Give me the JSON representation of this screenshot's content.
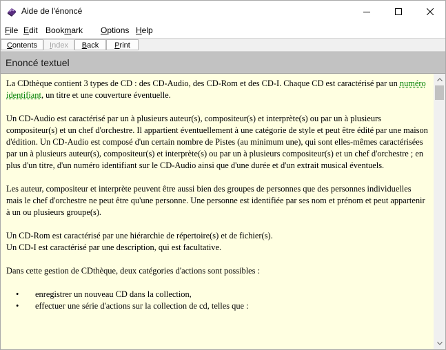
{
  "window": {
    "title": "Aide de l'énoncé"
  },
  "menu": [
    {
      "pre": "",
      "key": "F",
      "post": "ile"
    },
    {
      "pre": "",
      "key": "E",
      "post": "dit"
    },
    {
      "pre": "Book",
      "key": "m",
      "post": "ark"
    },
    {
      "pre": "",
      "key": "O",
      "post": "ptions"
    },
    {
      "pre": "",
      "key": "H",
      "post": "elp"
    }
  ],
  "toolbar": {
    "contents": {
      "pre": "",
      "key": "C",
      "post": "ontents"
    },
    "index": {
      "pre": "",
      "key": "I",
      "post": "ndex"
    },
    "back": {
      "pre": "",
      "key": "B",
      "post": "ack"
    },
    "print": {
      "pre": "",
      "key": "P",
      "post": "rint"
    }
  },
  "heading": "Enoncé textuel",
  "content": {
    "p1_before": "La CDthèque contient 3 types de CD : des CD-Audio, des CD-Rom et des CD-I. Chaque CD est caractérisé par un ",
    "p1_link": "numéro identifiant",
    "p1_after": ", un titre et une couverture éventuelle.",
    "p2": "Un CD-Audio est caractérisé par un à plusieurs auteur(s), compositeur(s) et interprète(s) ou par un à plusieurs compositeur(s) et un chef d'orchestre. Il appartient éventuellement à une catégorie de style et peut être édité par une maison d'édition. Un CD-Audio est composé d'un certain nombre de Pistes (au minimum une), qui sont elles-mêmes caractérisées par un à plusieurs auteur(s), compositeur(s) et interprète(s) ou par un à plusieurs compositeur(s) et un chef d'orchestre ; en plus d'un titre, d'un numéro identifiant sur le CD-Audio ainsi que d'une durée et d'un extrait musical éventuels.",
    "p3": "Les auteur, compositeur et interprète peuvent être aussi bien des groupes de personnes que des personnes individuelles mais le chef d'orchestre ne peut être qu'une personne. Une personne est identifiée par ses nom et prénom et peut appartenir à un ou plusieurs groupe(s).",
    "p4_line1": "Un CD-Rom est caractérisé par une hiérarchie de répertoire(s) et de fichier(s).",
    "p4_line2": "Un CD-I est caractérisé par une description, qui est facultative.",
    "p5": "Dans cette gestion de CDthèque, deux catégories d'actions sont possibles :",
    "bullets": [
      "enregistrer un nouveau CD dans la collection,",
      "effectuer une série d'actions sur la collection de cd, telles que :"
    ],
    "bullet_glyph": "•"
  },
  "colors": {
    "content_bg": "#ffffe1",
    "heading_bg": "#c2c2c2",
    "link": "#008000"
  }
}
